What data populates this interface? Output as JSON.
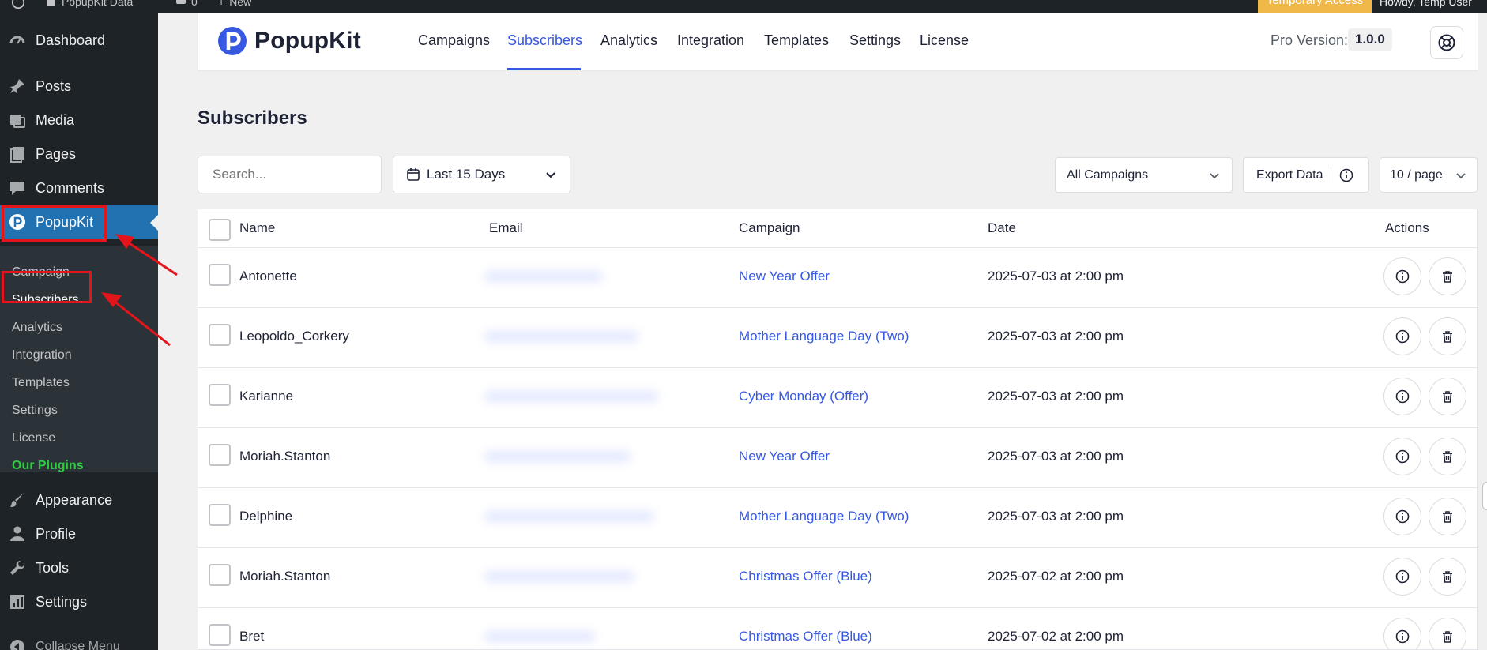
{
  "admin_bar": {
    "site_name": "PopupKit Data",
    "comments_count": "0",
    "new_label": "New",
    "temporary_access": "Temporary Access",
    "howdy": "Howdy, Temp User"
  },
  "sidebar": {
    "items": [
      {
        "label": "Dashboard",
        "icon": "dashboard-icon"
      },
      {
        "label": "Posts",
        "icon": "pin-icon"
      },
      {
        "label": "Media",
        "icon": "media-icon"
      },
      {
        "label": "Pages",
        "icon": "pages-icon"
      },
      {
        "label": "Comments",
        "icon": "comment-icon"
      },
      {
        "label": "PopupKit",
        "icon": "popupkit-icon"
      },
      {
        "label": "Appearance",
        "icon": "brush-icon"
      },
      {
        "label": "Profile",
        "icon": "user-icon"
      },
      {
        "label": "Tools",
        "icon": "wrench-icon"
      },
      {
        "label": "Settings",
        "icon": "settings-icon"
      }
    ],
    "submenu": [
      "Campaign",
      "Subscribers",
      "Analytics",
      "Integration",
      "Templates",
      "Settings",
      "License",
      "Our Plugins"
    ],
    "collapse_label": "Collapse Menu"
  },
  "topnav": {
    "logo_text": "PopupKit",
    "links": [
      "Campaigns",
      "Subscribers",
      "Analytics",
      "Integration",
      "Templates",
      "Settings",
      "License"
    ],
    "active_link": "Subscribers",
    "pro_label": "Pro Version:",
    "pro_version": "1.0.0"
  },
  "page": {
    "title": "Subscribers",
    "search_placeholder": "Search...",
    "date_filter": "Last 15 Days",
    "campaign_filter": "All Campaigns",
    "export_label": "Export Data",
    "per_page": "10 / page"
  },
  "table": {
    "headers": {
      "name": "Name",
      "email": "Email",
      "campaign": "Campaign",
      "date": "Date",
      "actions": "Actions"
    },
    "rows": [
      {
        "name": "Antonette",
        "campaign": "New Year Offer",
        "date": "2025-07-03 at 2:00 pm"
      },
      {
        "name": "Leopoldo_Corkery",
        "campaign": "Mother Language Day (Two)",
        "date": "2025-07-03 at 2:00 pm"
      },
      {
        "name": "Karianne",
        "campaign": "Cyber Monday (Offer)",
        "date": "2025-07-03 at 2:00 pm"
      },
      {
        "name": "Moriah.Stanton",
        "campaign": "New Year Offer",
        "date": "2025-07-03 at 2:00 pm"
      },
      {
        "name": "Delphine",
        "campaign": "Mother Language Day (Two)",
        "date": "2025-07-03 at 2:00 pm"
      },
      {
        "name": "Moriah.Stanton",
        "campaign": "Christmas Offer (Blue)",
        "date": "2025-07-02 at 2:00 pm"
      },
      {
        "name": "Bret",
        "campaign": "Christmas Offer (Blue)",
        "date": "2025-07-02 at 2:00 pm"
      }
    ]
  },
  "colors": {
    "wp_sidebar": "#1d2327",
    "wp_active": "#2271b1",
    "accent": "#3658e3",
    "highlight": "#e4141b",
    "temp_access": "#f0b849",
    "our_plugins": "#2ecc40"
  }
}
